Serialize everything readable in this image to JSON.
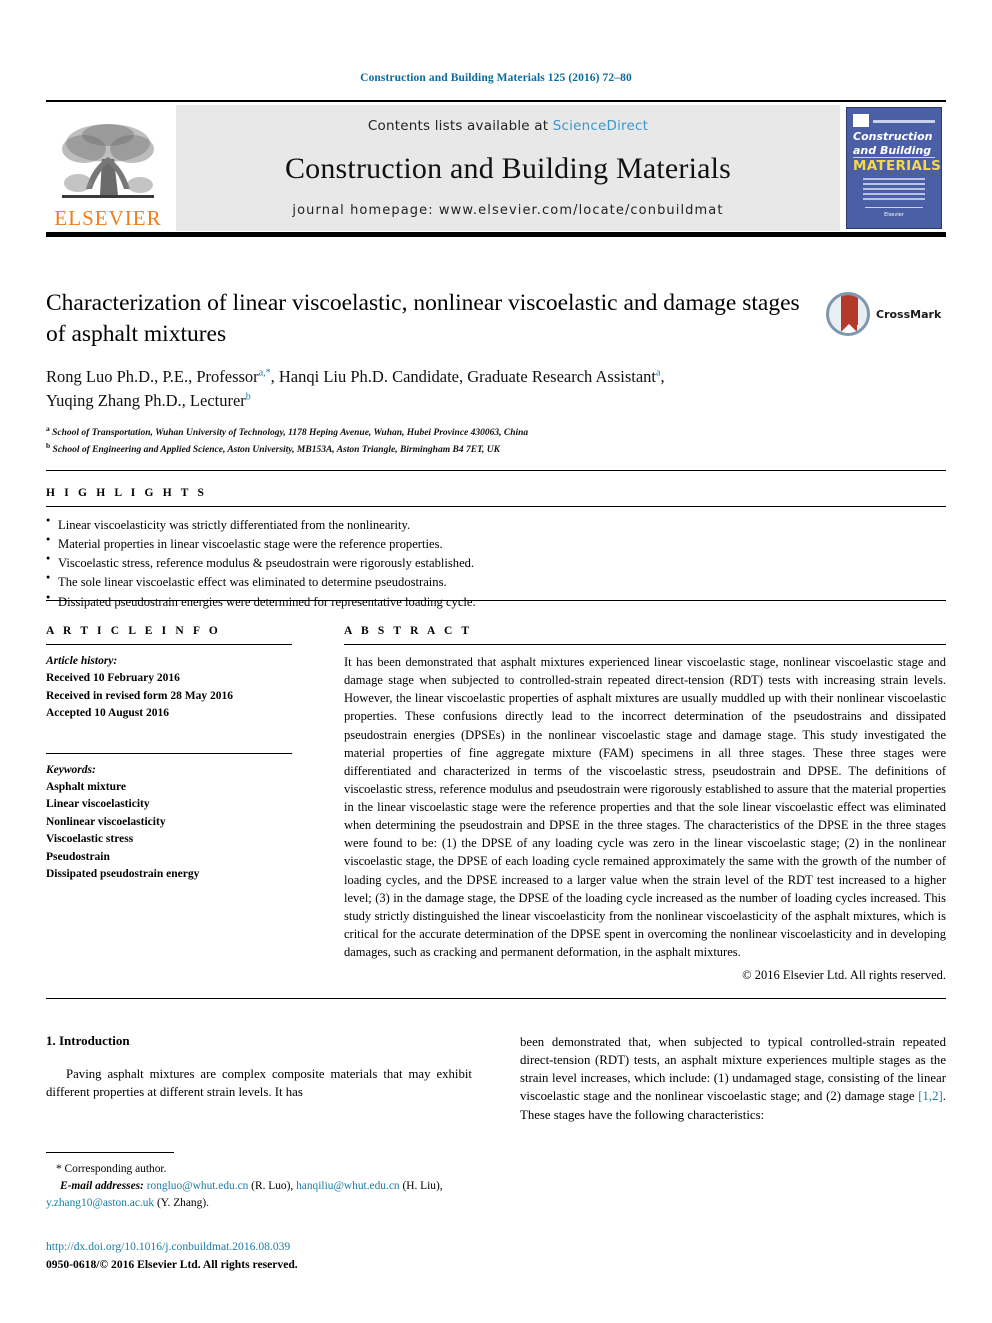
{
  "running_head": "Construction and Building Materials 125 (2016) 72–80",
  "masthead": {
    "publisher_logo_text": "ELSEVIER",
    "contents_prefix": "Contents lists available at ",
    "contents_link": "ScienceDirect",
    "journal_title": "Construction and Building Materials",
    "homepage_line": "journal homepage: www.elsevier.com/locate/conbuildmat",
    "cover": {
      "line1": "Construction",
      "line2": "and Building",
      "line3": "MATERIALS",
      "footer_text": "Elsevier"
    }
  },
  "article": {
    "title": "Characterization of linear viscoelastic, nonlinear viscoelastic and damage stages of asphalt mixtures",
    "crossmark_label": "CrossMark",
    "authors_line1_a": "Rong Luo Ph.D., P.E., Professor",
    "authors_line1_sup1": "a,*",
    "authors_line1_b": ", Hanqi Liu Ph.D. Candidate, Graduate Research Assistant",
    "authors_line1_sup2": "a",
    "authors_line1_c": ",",
    "authors_line2_a": "Yuqing Zhang Ph.D., Lecturer",
    "authors_line2_sup": "b",
    "affiliation_a_sup": "a",
    "affiliation_a": "School of Transportation, Wuhan University of Technology, 1178 Heping Avenue, Wuhan, Hubei Province 430063, China",
    "affiliation_b_sup": "b",
    "affiliation_b": "School of Engineering and Applied Science, Aston University, MB153A, Aston Triangle, Birmingham B4 7ET, UK"
  },
  "highlights": {
    "heading": "H I G H L I G H T S",
    "items": [
      "Linear viscoelasticity was strictly differentiated from the nonlinearity.",
      "Material properties in linear viscoelastic stage were the reference properties.",
      "Viscoelastic stress, reference modulus & pseudostrain were rigorously established.",
      "The sole linear viscoelastic effect was eliminated to determine pseudostrains.",
      "Dissipated pseudostrain energies were determined for representative loading cycle."
    ]
  },
  "article_info": {
    "heading": "A R T I C L E    I N F O",
    "history_title": "Article history:",
    "history": [
      "Received 10 February 2016",
      "Received in revised form 28 May 2016",
      "Accepted 10 August 2016"
    ],
    "keywords_title": "Keywords:",
    "keywords": [
      "Asphalt mixture",
      "Linear viscoelasticity",
      "Nonlinear viscoelasticity",
      "Viscoelastic stress",
      "Pseudostrain",
      "Dissipated pseudostrain energy"
    ]
  },
  "abstract": {
    "heading": "A B S T R A C T",
    "text": "It has been demonstrated that asphalt mixtures experienced linear viscoelastic stage, nonlinear viscoelastic stage and damage stage when subjected to controlled-strain repeated direct-tension (RDT) tests with increasing strain levels. However, the linear viscoelastic properties of asphalt mixtures are usually muddled up with their nonlinear viscoelastic properties. These confusions directly lead to the incorrect determination of the pseudostrains and dissipated pseudostrain energies (DPSEs) in the nonlinear viscoelastic stage and damage stage. This study investigated the material properties of fine aggregate mixture (FAM) specimens in all three stages. These three stages were differentiated and characterized in terms of the viscoelastic stress, pseudostrain and DPSE. The definitions of viscoelastic stress, reference modulus and pseudostrain were rigorously established to assure that the material properties in the linear viscoelastic stage were the reference properties and that the sole linear viscoelastic effect was eliminated when determining the pseudostrain and DPSE in the three stages. The characteristics of the DPSE in the three stages were found to be: (1) the DPSE of any loading cycle was zero in the linear viscoelastic stage; (2) in the nonlinear viscoelastic stage, the DPSE of each loading cycle remained approximately the same with the growth of the number of loading cycles, and the DPSE increased to a larger value when the strain level of the RDT test increased to a higher level; (3) in the damage stage, the DPSE of the loading cycle increased as the number of loading cycles increased. This study strictly distinguished the linear viscoelasticity from the nonlinear viscoelasticity of the asphalt mixtures, which is critical for the accurate determination of the DPSE spent in overcoming the nonlinear viscoelasticity and in developing damages, such as cracking and permanent deformation, in the asphalt mixtures.",
    "copyright": "© 2016 Elsevier Ltd. All rights reserved."
  },
  "body": {
    "section_heading": "1. Introduction",
    "para_left": "Paving asphalt mixtures are complex composite materials that may exhibit different properties at different strain levels. It has",
    "para_right_1": "been demonstrated that, when subjected to typical controlled-strain repeated direct-tension (RDT) tests, an asphalt mixture experiences multiple stages as the strain level increases, which include: (1) undamaged stage, consisting of the linear viscoelastic stage and the nonlinear viscoelastic stage; and (2) damage stage ",
    "para_right_ref": "[1,2]",
    "para_right_2": ". These stages have the following characteristics:"
  },
  "footnotes": {
    "corresponding": "* Corresponding author.",
    "email_label": "E-mail addresses:",
    "email_1": "rongluo@whut.edu.cn",
    "email_1_owner": " (R. Luo), ",
    "email_2": "hanqiliu@whut.edu.cn",
    "email_2_owner": " (H. Liu), ",
    "email_3": "y.zhang10@aston.ac.uk",
    "email_3_owner": " (Y. Zhang).",
    "doi": "http://dx.doi.org/10.1016/j.conbuildmat.2016.08.039",
    "issn": "0950-0618/© 2016 Elsevier Ltd. All rights reserved."
  },
  "colors": {
    "link": "#1b7ba6",
    "sciencedirect": "#3f96c8",
    "elsevier_orange": "#ef7d1a",
    "cover_blue": "#4a5fa5",
    "cover_yellow": "#f4d94a",
    "crossmark_red": "#b33a2a"
  }
}
